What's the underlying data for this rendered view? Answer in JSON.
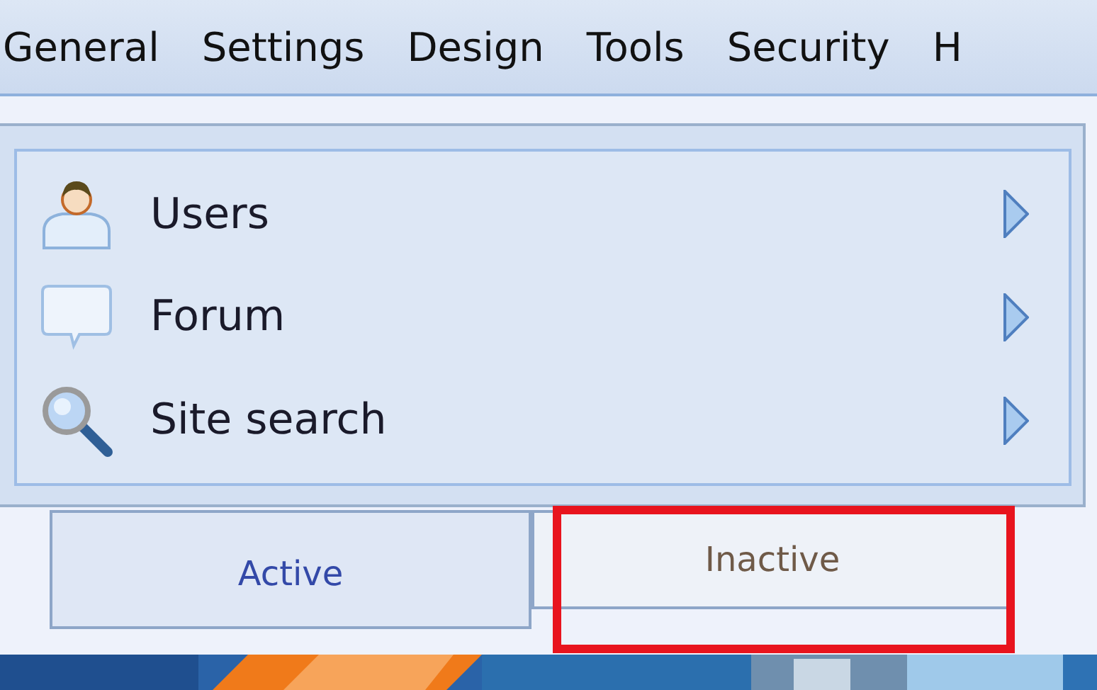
{
  "menu": [
    {
      "label": "General"
    },
    {
      "label": "Settings"
    },
    {
      "label": "Design"
    },
    {
      "label": "Tools"
    },
    {
      "label": "Security"
    },
    {
      "label": "H"
    }
  ],
  "items": [
    {
      "label": "Users"
    },
    {
      "label": "Forum"
    },
    {
      "label": "Site search"
    }
  ],
  "tabs": [
    {
      "label": "Active",
      "selected": true
    },
    {
      "label": "Inactive",
      "selected": false
    }
  ]
}
